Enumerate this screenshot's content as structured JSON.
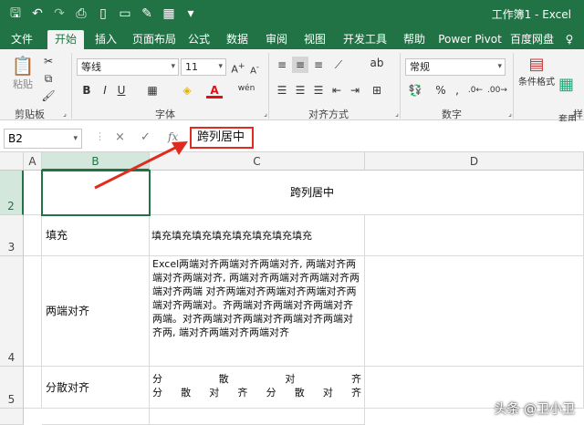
{
  "window": {
    "title": "工作簿1 - Excel"
  },
  "qat": {
    "icons": [
      "save-icon",
      "undo-icon",
      "redo-icon",
      "print-preview-icon",
      "new-icon",
      "open-icon",
      "format-painter-icon",
      "table-icon",
      "customize-icon"
    ]
  },
  "tabs": [
    {
      "label": "文件"
    },
    {
      "label": "开始"
    },
    {
      "label": "插入"
    },
    {
      "label": "页面布局"
    },
    {
      "label": "公式"
    },
    {
      "label": "数据"
    },
    {
      "label": "审阅"
    },
    {
      "label": "视图"
    },
    {
      "label": "开发工具"
    },
    {
      "label": "帮助"
    },
    {
      "label": "Power Pivot"
    },
    {
      "label": "百度网盘"
    },
    {
      "label": "♀"
    }
  ],
  "ribbon": {
    "clipboard": {
      "paste": "粘贴",
      "label": "剪贴板"
    },
    "font": {
      "name": "等线",
      "size": "11",
      "bold": "B",
      "italic": "I",
      "underline": "U",
      "wen": "wén",
      "label": "字体"
    },
    "alignment": {
      "label": "对齐方式"
    },
    "number": {
      "format": "常规",
      "percent": "%",
      "comma": ",",
      "label": "数字"
    },
    "styles": {
      "conditional": "条件格式",
      "table": "套用\n表格格",
      "label": "样"
    }
  },
  "formula_bar": {
    "name_box": "B2",
    "cancel": "×",
    "enter": "✓",
    "fx": "fx",
    "content": "跨列居中"
  },
  "columns": [
    {
      "label": "A"
    },
    {
      "label": "B"
    },
    {
      "label": "C"
    },
    {
      "label": "D"
    }
  ],
  "rows": [
    {
      "num": "2",
      "b": "",
      "c": "跨列居中"
    },
    {
      "num": "3",
      "b": "填充",
      "c": "填充填充填充填充填充填充填充填充"
    },
    {
      "num": "4",
      "b": "两端对齐",
      "c": "Excel两端对齐两端对齐两端对齐, 两端对齐两端对齐两端对齐, 两端对齐两端对齐两端对齐两端对齐两端 对齐两端对齐两端对齐两端对齐两端对齐两端对。齐两端对齐两端对齐两端对齐两端。对齐两端对齐两端对齐两端对齐两端对齐两, 端对齐两端对齐两端对齐"
    },
    {
      "num": "5",
      "b": "分散对齐",
      "c1": [
        "分",
        "散",
        "对",
        "齐"
      ],
      "c2": [
        "分",
        "散",
        "对",
        "齐",
        "分",
        "散",
        "对",
        "齐"
      ]
    }
  ],
  "watermark": "头条 @卫小卫",
  "colors": {
    "accent": "#217346",
    "highlight_box": "#e02b20",
    "arrow": "#e02b20"
  }
}
